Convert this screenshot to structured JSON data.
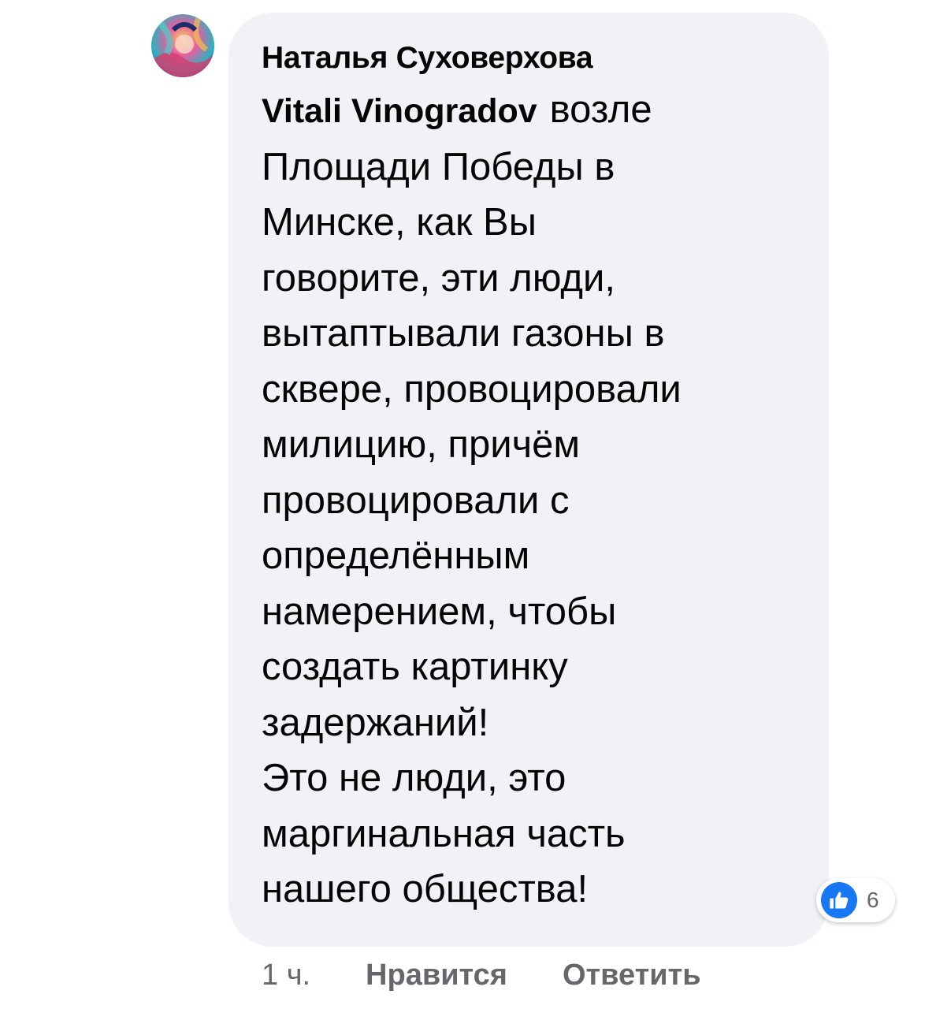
{
  "comment": {
    "author": "Наталья Суховерхова",
    "mention": "Vitali Vinogradov",
    "text_lines": [
      "возле",
      "Площади Победы в",
      "Минске, как Вы",
      "говорите, эти люди,",
      "вытаптывали газоны в",
      "сквере, провоцировали",
      "милицию, причём",
      "провоцировали с",
      "определённым",
      "намерением, чтобы",
      "создать картинку",
      "задержаний!",
      "Это не люди, это",
      "маргинальная часть",
      "нашего общества!"
    ],
    "reactions": {
      "icon": "like-icon",
      "count": "6",
      "color": "#1877f2"
    },
    "time": "1 ч.",
    "like_label": "Нравится",
    "reply_label": "Ответить"
  },
  "colors": {
    "bubble": "#f0f2f5",
    "text": "#050505",
    "secondary": "#65676b"
  }
}
